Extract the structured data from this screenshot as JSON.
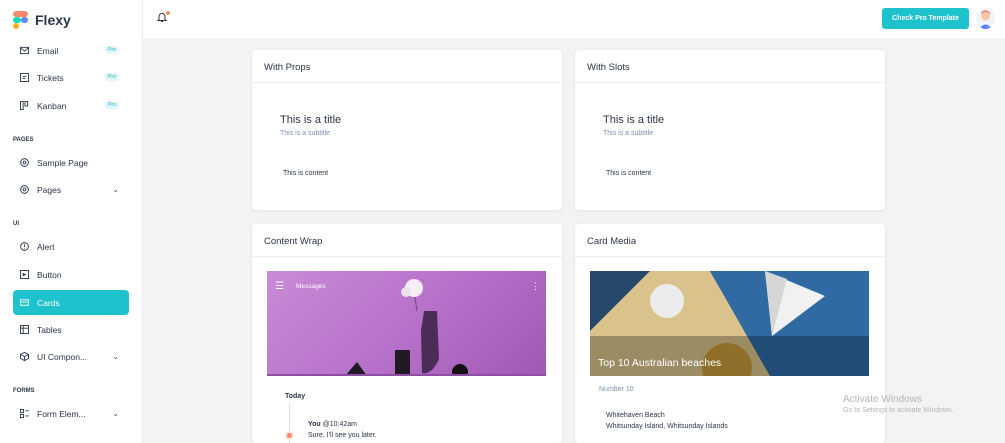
{
  "app": {
    "name": "Flexy"
  },
  "sidebar": {
    "items_top": [
      {
        "label": "Email",
        "badge": "Pro",
        "icon": "mail-icon"
      },
      {
        "label": "Tickets",
        "badge": "Pro",
        "icon": "ticket-icon"
      },
      {
        "label": "Kanban",
        "badge": "Pro",
        "icon": "kanban-icon"
      }
    ],
    "section_pages": "PAGES",
    "pages_items": [
      {
        "label": "Sample Page",
        "icon": "aperture-icon"
      },
      {
        "label": "Pages",
        "icon": "aperture-icon"
      }
    ],
    "section_ui": "UI",
    "ui_items": [
      {
        "label": "Alert",
        "icon": "alert-circle-icon"
      },
      {
        "label": "Button",
        "icon": "button-icon"
      },
      {
        "label": "Cards",
        "icon": "cards-icon",
        "active": true
      },
      {
        "label": "Tables",
        "icon": "table-icon"
      },
      {
        "label": "UI Compon...",
        "icon": "package-icon"
      }
    ],
    "section_forms": "FORMS",
    "forms_items": [
      {
        "label": "Form Elem...",
        "icon": "form-icon"
      }
    ]
  },
  "topbar": {
    "cta_label": "Check Pro Template",
    "accent_color": "#1ec2cc",
    "notification_color": "#fa896b"
  },
  "cards": {
    "props": {
      "heading": "With Props",
      "title": "This is a title",
      "subtitle": "This is a subtitle",
      "content": "This is content"
    },
    "slots": {
      "heading": "With Slots",
      "title": "This is a title",
      "subtitle": "This is a subtitle",
      "content": "This is content"
    },
    "wrap": {
      "heading": "Content Wrap",
      "media_bar_label": "Messages",
      "timeline_label": "Today",
      "message_author": "You",
      "message_time": "@10:42am",
      "message_text": "Sure, I'll see you later."
    },
    "media": {
      "heading": "Card Media",
      "overlay_title": "Top 10 Australian beaches",
      "subtitle": "Number 10",
      "line1": "Whitehaven Beach",
      "line2": "Whitsunday Island, Whitsunday Islands"
    }
  },
  "watermark": {
    "line1": "Activate Windows",
    "line2": "Go to Settings to activate Windows."
  }
}
